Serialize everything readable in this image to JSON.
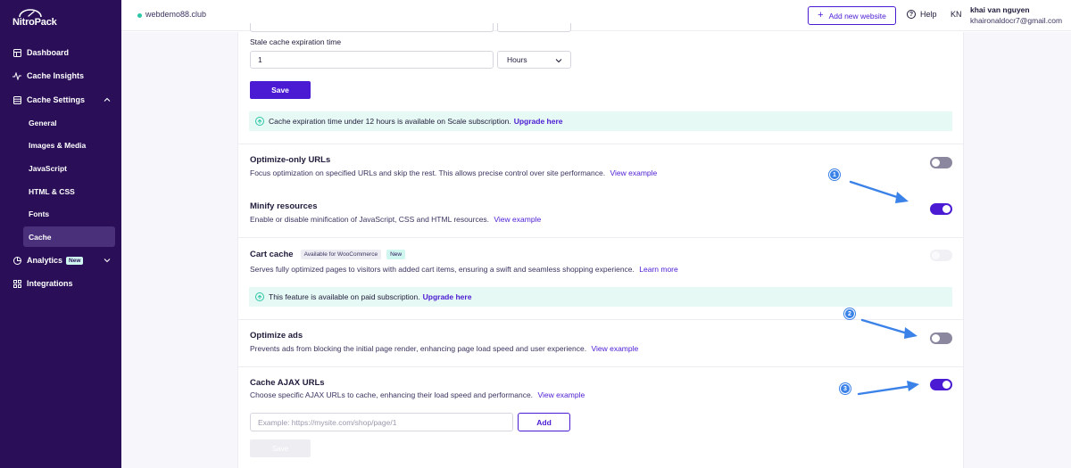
{
  "brand": {
    "logo_text": "NitroPack"
  },
  "sidebar": {
    "items": [
      {
        "label": "Dashboard",
        "icon": "dashboard-icon"
      },
      {
        "label": "Cache Insights",
        "icon": "insights-icon"
      },
      {
        "label": "Cache Settings",
        "icon": "cache-settings-icon"
      },
      {
        "label": "Analytics",
        "icon": "analytics-icon",
        "badge": "New"
      },
      {
        "label": "Integrations",
        "icon": "integrations-icon"
      }
    ],
    "sub_items": [
      "General",
      "Images & Media",
      "JavaScript",
      "HTML & CSS",
      "Fonts",
      "Cache"
    ],
    "active_sub": "Cache"
  },
  "topbar": {
    "site": "webdemo88.club",
    "add_website": "Add new website",
    "help": "Help",
    "avatar_initials": "KN",
    "user_name": "khai van nguyen",
    "user_email": "khaironaldocr7@gmail.com"
  },
  "stale_cache": {
    "label": "Stale cache expiration time",
    "value": "1",
    "unit": "Hours",
    "save": "Save"
  },
  "notice_expiration": {
    "text": "Cache expiration time under 12 hours is available on Scale subscription.",
    "link": "Upgrade here"
  },
  "sections": {
    "optimize_only": {
      "title": "Optimize-only URLs",
      "desc": "Focus optimization on specified URLs and skip the rest. This allows precise control over site performance.",
      "link": "View example",
      "enabled": false
    },
    "minify": {
      "title": "Minify resources",
      "desc": "Enable or disable minification of JavaScript, CSS and HTML resources.",
      "link": "View example",
      "enabled": true
    },
    "cart_cache": {
      "title": "Cart cache",
      "tag_available": "Available for WooCommerce",
      "tag_new": "New",
      "desc": "Serves fully optimized pages to visitors with added cart items, ensuring a swift and seamless shopping experience.",
      "link": "Learn more",
      "enabled": false,
      "disabled": true
    },
    "optimize_ads": {
      "title": "Optimize ads",
      "desc": "Prevents ads from blocking the initial page render, enhancing page load speed and user experience.",
      "link": "View example",
      "enabled": false
    },
    "cache_ajax": {
      "title": "Cache AJAX URLs",
      "desc": "Choose specific AJAX URLs to cache, enhancing their load speed and performance.",
      "link": "View example",
      "enabled": true,
      "input_placeholder": "Example: https://mysite.com/shop/page/1",
      "add": "Add",
      "save": "Save"
    }
  },
  "notice_paid": {
    "text": "This feature is available on paid subscription.",
    "link": "Upgrade here"
  },
  "annotations": [
    "1",
    "2",
    "3"
  ],
  "colors": {
    "sidebar_bg": "#2a0f58",
    "accent": "#4b1bd3",
    "notice_bg": "#e6f9f4",
    "annotation": "#3b82e8"
  }
}
